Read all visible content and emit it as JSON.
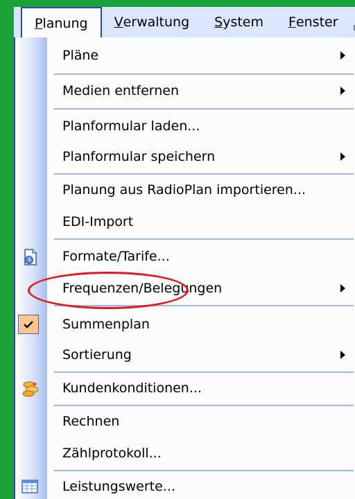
{
  "menubar": {
    "items": [
      {
        "mnemonic": "P",
        "rest": "lanung"
      },
      {
        "mnemonic": "V",
        "rest": "erwaltung"
      },
      {
        "mnemonic": "S",
        "rest": "ystem"
      },
      {
        "mnemonic": "F",
        "rest": "enster"
      }
    ]
  },
  "menu": {
    "items": [
      {
        "label": "Pläne",
        "submenu": true
      },
      {
        "label": "Medien entfernen",
        "submenu": true
      },
      {
        "label": "Planformular laden...",
        "submenu": false
      },
      {
        "label": "Planformular speichern",
        "submenu": true
      },
      {
        "label": "Planung aus RadioPlan importieren...",
        "submenu": false
      },
      {
        "label": "EDI-Import",
        "submenu": false
      },
      {
        "label": "Formate/Tarife...",
        "submenu": false,
        "icon": "document-clock-icon"
      },
      {
        "label": "Frequenzen/Belegungen",
        "submenu": true
      },
      {
        "label": "Summenplan",
        "submenu": false,
        "checked": true,
        "icon": "checkmark-icon"
      },
      {
        "label": "Sortierung",
        "submenu": true
      },
      {
        "label": "Kundenkonditionen...",
        "submenu": false,
        "icon": "coins-icon"
      },
      {
        "label": "Rechnen",
        "submenu": false
      },
      {
        "label": "Zählprotokoll...",
        "submenu": false
      },
      {
        "label": "Leistungswerte...",
        "submenu": false,
        "icon": "table-icon"
      }
    ]
  },
  "annotation": {
    "shape": "ellipse",
    "color": "#e4161f",
    "target": "Summenplan"
  },
  "colors": {
    "desktop": "#1aa33a",
    "menubar": "#d9e6fb",
    "border": "#1f4fa4",
    "check_bg": "#ffc58e",
    "highlight": "#e4161f"
  }
}
